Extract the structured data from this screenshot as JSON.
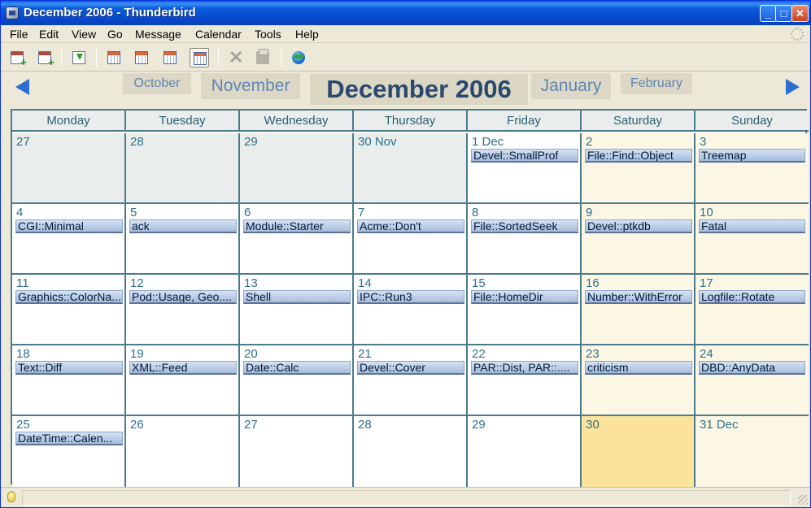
{
  "window": {
    "title": "December 2006 - Thunderbird"
  },
  "window_buttons": {
    "minimize": "_",
    "maximize": "□",
    "close": "✕"
  },
  "menu": [
    "File",
    "Edit",
    "View",
    "Go",
    "Message",
    "Calendar",
    "Tools",
    "Help"
  ],
  "toolbar": {
    "buttons": [
      {
        "name": "new-event-button",
        "icon": "new-event-icon"
      },
      {
        "name": "new-task-button",
        "icon": "new-task-icon"
      },
      {
        "name": "subscribe-button",
        "icon": "subscribe-icon"
      },
      {
        "name": "day-view-button",
        "icon": "day-view-icon"
      },
      {
        "name": "week-view-button",
        "icon": "week-view-icon"
      },
      {
        "name": "multiweek-view-button",
        "icon": "multiweek-view-icon"
      },
      {
        "name": "month-view-button",
        "icon": "month-view-icon",
        "active": true
      },
      {
        "name": "delete-button",
        "icon": "delete-icon"
      },
      {
        "name": "print-button",
        "icon": "print-icon"
      },
      {
        "name": "publish-button",
        "icon": "globe-icon"
      }
    ]
  },
  "month_nav": {
    "prev2": "October",
    "prev1": "November",
    "current": "December 2006",
    "next1": "January",
    "next2": "February"
  },
  "weekdays": [
    "Monday",
    "Tuesday",
    "Wednesday",
    "Thursday",
    "Friday",
    "Saturday",
    "Sunday"
  ],
  "weeks": [
    [
      {
        "day": "27",
        "other": true,
        "event": null
      },
      {
        "day": "28",
        "other": true,
        "event": null
      },
      {
        "day": "29",
        "other": true,
        "event": null
      },
      {
        "day": "30 Nov",
        "other": true,
        "event": null
      },
      {
        "day": "1 Dec",
        "event": "Devel::SmallProf"
      },
      {
        "day": "2",
        "event": "File::Find::Object"
      },
      {
        "day": "3",
        "event": "Treemap"
      }
    ],
    [
      {
        "day": "4",
        "event": "CGI::Minimal"
      },
      {
        "day": "5",
        "event": "ack"
      },
      {
        "day": "6",
        "event": "Module::Starter"
      },
      {
        "day": "7",
        "event": "Acme::Don't"
      },
      {
        "day": "8",
        "event": "File::SortedSeek"
      },
      {
        "day": "9",
        "event": "Devel::ptkdb"
      },
      {
        "day": "10",
        "event": "Fatal"
      }
    ],
    [
      {
        "day": "11",
        "event": "Graphics::ColorNa..."
      },
      {
        "day": "12",
        "event": "Pod::Usage, Geo...."
      },
      {
        "day": "13",
        "event": "Shell"
      },
      {
        "day": "14",
        "event": "IPC::Run3"
      },
      {
        "day": "15",
        "event": "File::HomeDir"
      },
      {
        "day": "16",
        "event": "Number::WithError"
      },
      {
        "day": "17",
        "event": "Logfile::Rotate"
      }
    ],
    [
      {
        "day": "18",
        "event": "Text::Diff"
      },
      {
        "day": "19",
        "event": "XML::Feed"
      },
      {
        "day": "20",
        "event": "Date::Calc"
      },
      {
        "day": "21",
        "event": "Devel::Cover"
      },
      {
        "day": "22",
        "event": "PAR::Dist, PAR::...."
      },
      {
        "day": "23",
        "event": "criticism"
      },
      {
        "day": "24",
        "event": "DBD::AnyData"
      }
    ],
    [
      {
        "day": "25",
        "event": "DateTime::Calen..."
      },
      {
        "day": "26",
        "event": null
      },
      {
        "day": "27",
        "event": null
      },
      {
        "day": "28",
        "event": null
      },
      {
        "day": "29",
        "event": null
      },
      {
        "day": "30",
        "today": true,
        "event": null
      },
      {
        "day": "31 Dec",
        "event": null
      }
    ]
  ],
  "colors": {
    "accent": "#2d6fd0",
    "grid": "#4d7b8b",
    "today": "#fce39b",
    "weekend": "#fcf7e5"
  },
  "status": {
    "text": ""
  }
}
